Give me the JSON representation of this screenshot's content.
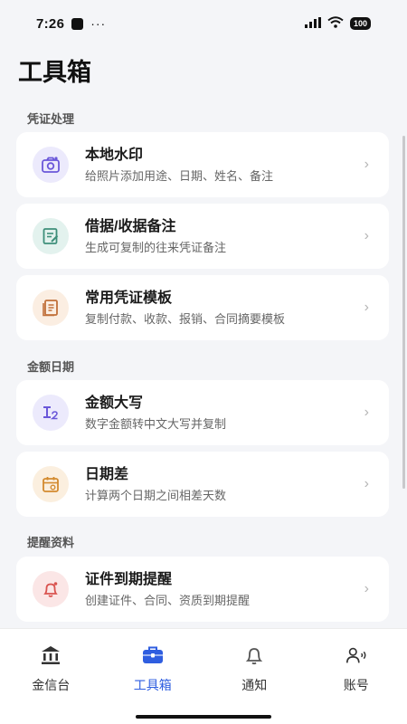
{
  "status": {
    "time": "7:26",
    "dots": "···",
    "battery": "100"
  },
  "page_title": "工具箱",
  "sections": [
    {
      "label": "凭证处理",
      "items": [
        {
          "title": "本地水印",
          "subtitle": "给照片添加用途、日期、姓名、备注",
          "icon": "camera-icon",
          "tint": "#eceafc",
          "color": "#6a57d9"
        },
        {
          "title": "借据/收据备注",
          "subtitle": "生成可复制的往来凭证备注",
          "icon": "edit-note-icon",
          "tint": "#e3f2ee",
          "color": "#3e8f7a"
        },
        {
          "title": "常用凭证模板",
          "subtitle": "复制付款、收款、报销、合同摘要模板",
          "icon": "document-icon",
          "tint": "#fbeee2",
          "color": "#c1703a"
        }
      ]
    },
    {
      "label": "金额日期",
      "items": [
        {
          "title": "金额大写",
          "subtitle": "数字金额转中文大写并复制",
          "icon": "text-convert-icon",
          "tint": "#eceafc",
          "color": "#6a57d9"
        },
        {
          "title": "日期差",
          "subtitle": "计算两个日期之间相差天数",
          "icon": "calendar-icon",
          "tint": "#fbefdf",
          "color": "#d38a2e"
        }
      ]
    },
    {
      "label": "提醒资料",
      "items": [
        {
          "title": "证件到期提醒",
          "subtitle": "创建证件、合同、资质到期提醒",
          "icon": "bell-icon",
          "tint": "#fbe6e6",
          "color": "#d9534f"
        }
      ]
    }
  ],
  "tabs": [
    {
      "label": "金信台",
      "icon": "bank-icon",
      "active": false
    },
    {
      "label": "工具箱",
      "icon": "toolbox-icon",
      "active": true
    },
    {
      "label": "通知",
      "icon": "bell-outline-icon",
      "active": false
    },
    {
      "label": "账号",
      "icon": "account-icon",
      "active": false
    }
  ],
  "colors": {
    "accent": "#2f5ee0",
    "background": "#f4f5f8"
  }
}
